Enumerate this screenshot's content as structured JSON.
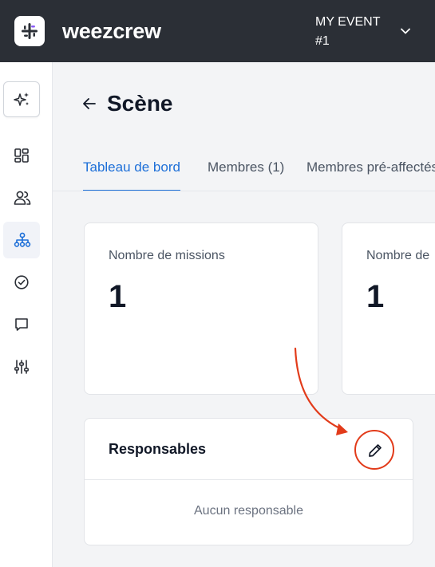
{
  "header": {
    "brand": "weezcrew",
    "event_line1": "MY EVENT",
    "event_line2": "#1"
  },
  "sidebar": {
    "items": [
      {
        "icon": "sparkle-icon"
      },
      {
        "icon": "dashboard-icon"
      },
      {
        "icon": "users-icon"
      },
      {
        "icon": "org-chart-icon",
        "active": true
      },
      {
        "icon": "check-circle-icon"
      },
      {
        "icon": "chat-icon"
      },
      {
        "icon": "sliders-icon"
      }
    ]
  },
  "page": {
    "title": "Scène"
  },
  "tabs": [
    {
      "label": "Tableau de bord",
      "active": true
    },
    {
      "label": "Membres (1)"
    },
    {
      "label": "Membres pré-affectés"
    }
  ],
  "stats": [
    {
      "label": "Nombre de missions",
      "value": "1"
    },
    {
      "label": "Nombre de",
      "value": "1"
    }
  ],
  "responsables": {
    "title": "Responsables",
    "empty_text": "Aucun responsable"
  },
  "colors": {
    "topbar": "#2b2f36",
    "accent": "#1d6fd8",
    "annotation": "#e23b1a"
  }
}
